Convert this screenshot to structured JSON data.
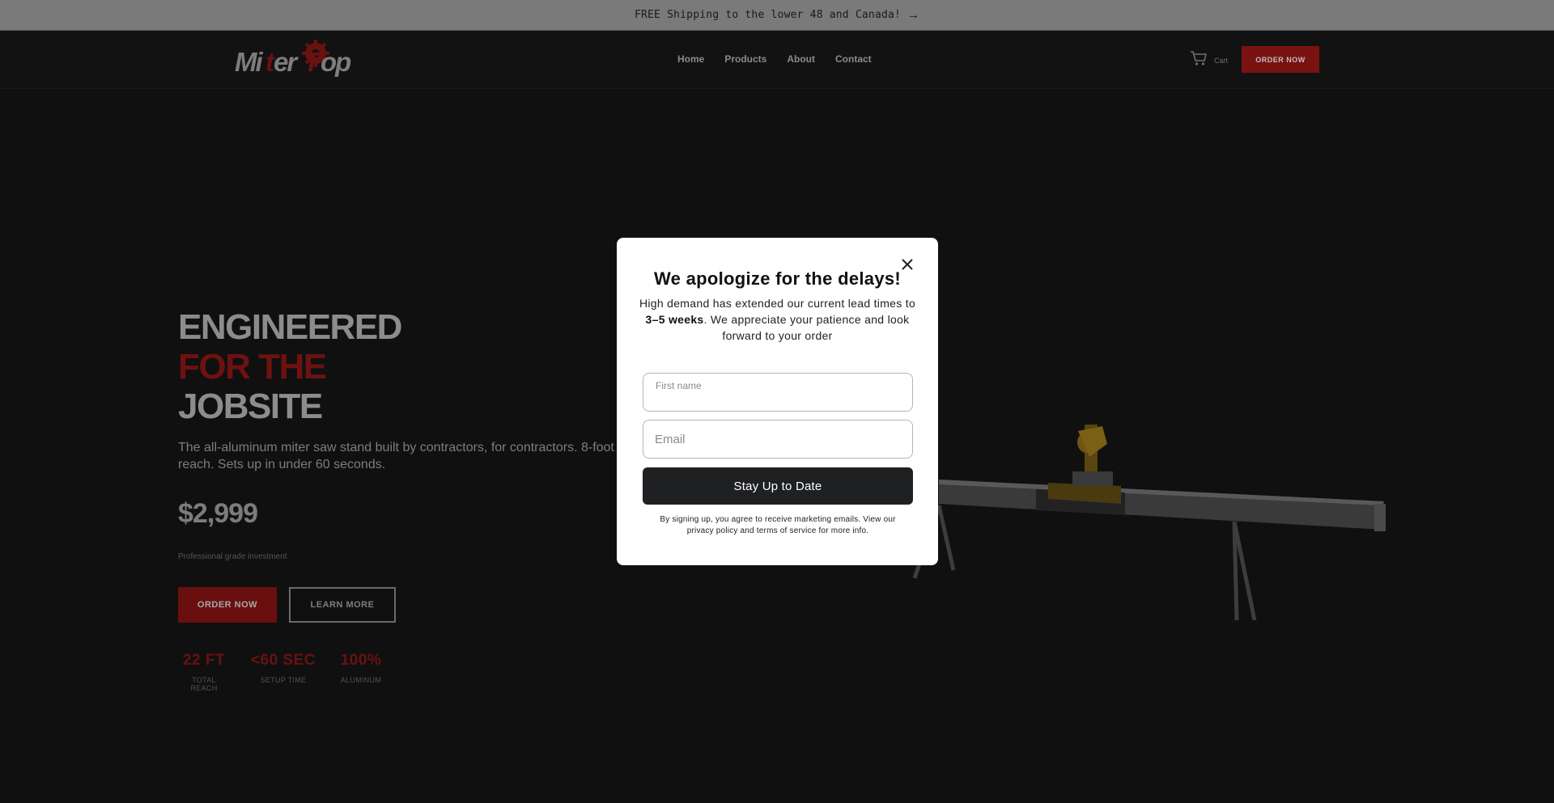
{
  "announcement": {
    "text": "FREE Shipping to the lower 48 and Canada!",
    "arrow_icon": "arrow-right-icon"
  },
  "header": {
    "logo_text": "MiterTop",
    "nav": [
      {
        "label": "Home"
      },
      {
        "label": "Products"
      },
      {
        "label": "About"
      },
      {
        "label": "Contact"
      }
    ],
    "cart_label": "Cart",
    "cart_icon": "cart-icon",
    "order_button": "ORDER NOW"
  },
  "hero": {
    "title_line1": "ENGINEERED",
    "title_line2": "FOR THE",
    "title_line3": "JOBSITE",
    "description": "The all-aluminum miter saw stand built by contractors, for contractors. 8-foot reach. Sets up in under 60 seconds.",
    "price": "$2,999",
    "price_note": "Professional grade investment",
    "order_button": "ORDER NOW",
    "learn_button": "LEARN MORE",
    "stats": [
      {
        "value": "22 FT",
        "label": "TOTAL REACH"
      },
      {
        "value": "<60 SEC",
        "label": "SETUP TIME"
      },
      {
        "value": "100%",
        "label": "ALUMINUM"
      }
    ]
  },
  "modal": {
    "title": "We apologize for the delays!",
    "message_pre": "High demand has extended our current lead times to ",
    "message_bold": "3–5 weeks",
    "message_post": ". We appreciate your patience and look forward to your order",
    "first_name_label": "First name",
    "first_name_value": "",
    "email_placeholder": "Email",
    "submit_label": "Stay Up to Date",
    "legal": "By signing up, you agree to receive marketing emails. View our privacy policy and terms of service for more info.",
    "close_icon": "close-icon"
  },
  "colors": {
    "accent": "#7a1212",
    "background": "#101010",
    "modal_button": "#1f2022"
  }
}
